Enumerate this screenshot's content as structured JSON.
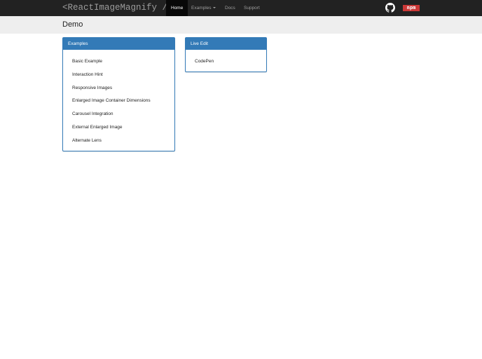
{
  "navbar": {
    "brand": "<ReactImageMagnify />",
    "items": [
      {
        "label": "Home",
        "active": true
      },
      {
        "label": "Examples"
      },
      {
        "label": "Docs"
      },
      {
        "label": "Support"
      }
    ],
    "github_icon": "github-icon",
    "npm_label": "npm"
  },
  "page": {
    "title": "Demo"
  },
  "examples_panel": {
    "title": "Examples",
    "items": [
      "Basic Example",
      "Interaction Hint",
      "Responsive Images",
      "Enlarged Image Container Dimensions",
      "Carousel Integration",
      "External Enlarged Image",
      "Alternate Lens"
    ]
  },
  "live_edit_panel": {
    "title": "Live Edit",
    "items": [
      "CodePen"
    ]
  },
  "colors": {
    "navbar": "#222222",
    "primary": "#337ab7",
    "npm": "#cb3837"
  }
}
